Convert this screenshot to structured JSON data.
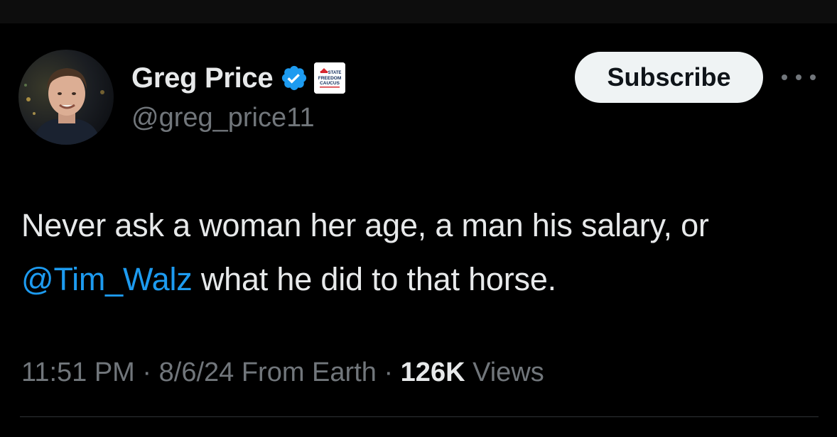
{
  "user": {
    "display_name": "Greg Price",
    "handle": "@greg_price11",
    "affiliate_badge": {
      "line1": "STATE",
      "line2": "FREEDOM",
      "line3": "CAUCUS"
    }
  },
  "actions": {
    "subscribe_label": "Subscribe",
    "more_icon": "more-horizontal-icon"
  },
  "tweet": {
    "text_part1": "Never ask a woman her age, a man his salary, or ",
    "mention": "@Tim_Walz",
    "text_part2": " what he did to that horse."
  },
  "meta": {
    "time": "11:51 PM",
    "date": "8/6/24",
    "location": "From Earth",
    "views_count": "126K",
    "views_label": "Views",
    "separator": "·"
  },
  "colors": {
    "background": "#000000",
    "primary_text": "#e7e9ea",
    "secondary_text": "#71767b",
    "link": "#1d9bf0",
    "verified": "#1d9bf0"
  }
}
